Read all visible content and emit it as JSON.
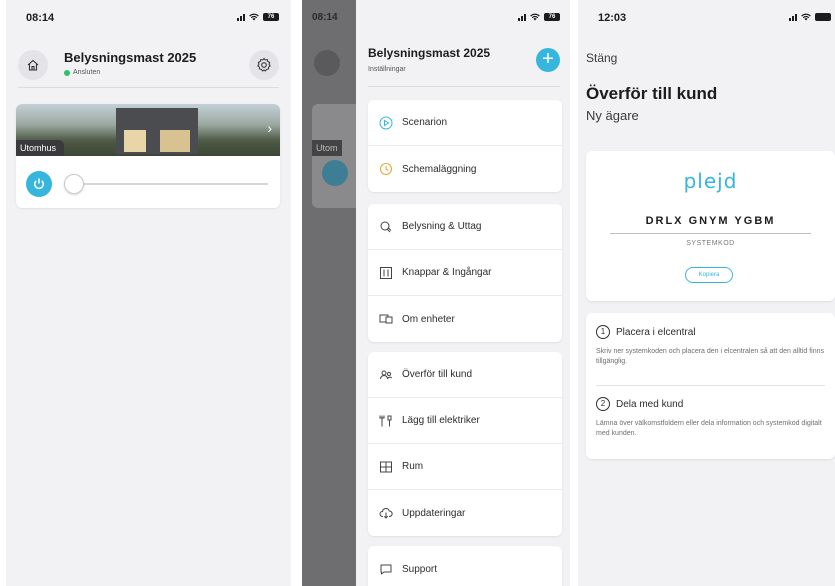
{
  "panel1": {
    "status": {
      "time": "08:14",
      "battery": "76"
    },
    "header": {
      "title": "Belysningsmast 2025",
      "status": "Ansluten"
    },
    "room": {
      "name": "Utomhus"
    },
    "icons": {
      "home": "home-icon",
      "settings": "gear-icon",
      "power": "power-icon",
      "chevron": "chevron-right-icon"
    }
  },
  "panel2": {
    "status": {
      "dim_time": "08:14",
      "battery": "76"
    },
    "header": {
      "title": "Belysningsmast 2025",
      "subtitle": "Inställningar",
      "add": "+"
    },
    "groups": [
      [
        {
          "label": "Scenarion",
          "icon": "play-icon"
        },
        {
          "label": "Schemaläggning",
          "icon": "clock-icon"
        }
      ],
      [
        {
          "label": "Belysning & Uttag",
          "icon": "bulb-icon"
        },
        {
          "label": "Knappar & Ingångar",
          "icon": "panel-icon"
        },
        {
          "label": "Om enheter",
          "icon": "devices-icon"
        }
      ],
      [
        {
          "label": "Överför till kund",
          "icon": "users-icon"
        },
        {
          "label": "Lägg till elektriker",
          "icon": "tools-icon"
        },
        {
          "label": "Rum",
          "icon": "rooms-icon"
        },
        {
          "label": "Uppdateringar",
          "icon": "cloud-download-icon"
        }
      ],
      [
        {
          "label": "Support",
          "icon": "chat-icon"
        }
      ]
    ]
  },
  "panel3": {
    "status": {
      "time": "12:03"
    },
    "close": "Stäng",
    "title": "Överför till kund",
    "subtitle": "Ny ägare",
    "logo": "pleјd",
    "code": "DRLX GNYM YGBM",
    "code_label": "SYSTEMKOD",
    "copy": "Kopiera",
    "steps": [
      {
        "num": "1",
        "title": "Placera i elcentral",
        "body": "Skriv ner systemkoden och placera den i elcentralen så att den alltid finns tillgänglig."
      },
      {
        "num": "2",
        "title": "Dela med kund",
        "body": "Lämna över välkomstfoldern eller dela information och systemkod digitalt med kunden."
      }
    ]
  },
  "colors": {
    "accent": "#36b6dc",
    "online": "#27c46a",
    "background": "#f2f2f4"
  }
}
